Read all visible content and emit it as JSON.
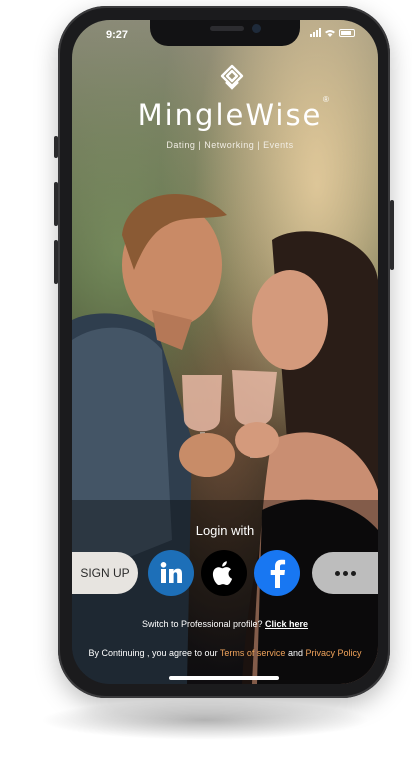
{
  "status_bar": {
    "time": "9:27"
  },
  "brand": {
    "name": "MingleWise",
    "registered_mark": "®",
    "tagline": "Dating | Networking | Events"
  },
  "login": {
    "prompt": "Login with",
    "signup_label": "SIGN UP",
    "providers": [
      {
        "name": "LinkedIn",
        "icon": "linkedin-icon",
        "color": "#1d6fb8"
      },
      {
        "name": "Apple",
        "icon": "apple-icon",
        "color": "#000000"
      },
      {
        "name": "Facebook",
        "icon": "facebook-icon",
        "color": "#1877f2"
      }
    ],
    "more_icon": "more-dots-icon"
  },
  "footer": {
    "switch_text": "Switch to Professional profile?",
    "switch_link": "Click here",
    "terms_prefix": "By Continuing , you agree to our",
    "terms_link": "Terms of service",
    "and_text": "and",
    "privacy_link": "Privacy Policy"
  },
  "colors": {
    "accent_link": "#f0a35b",
    "signup_bg": "#e7e4e0",
    "more_bg": "#bdbdbd"
  }
}
